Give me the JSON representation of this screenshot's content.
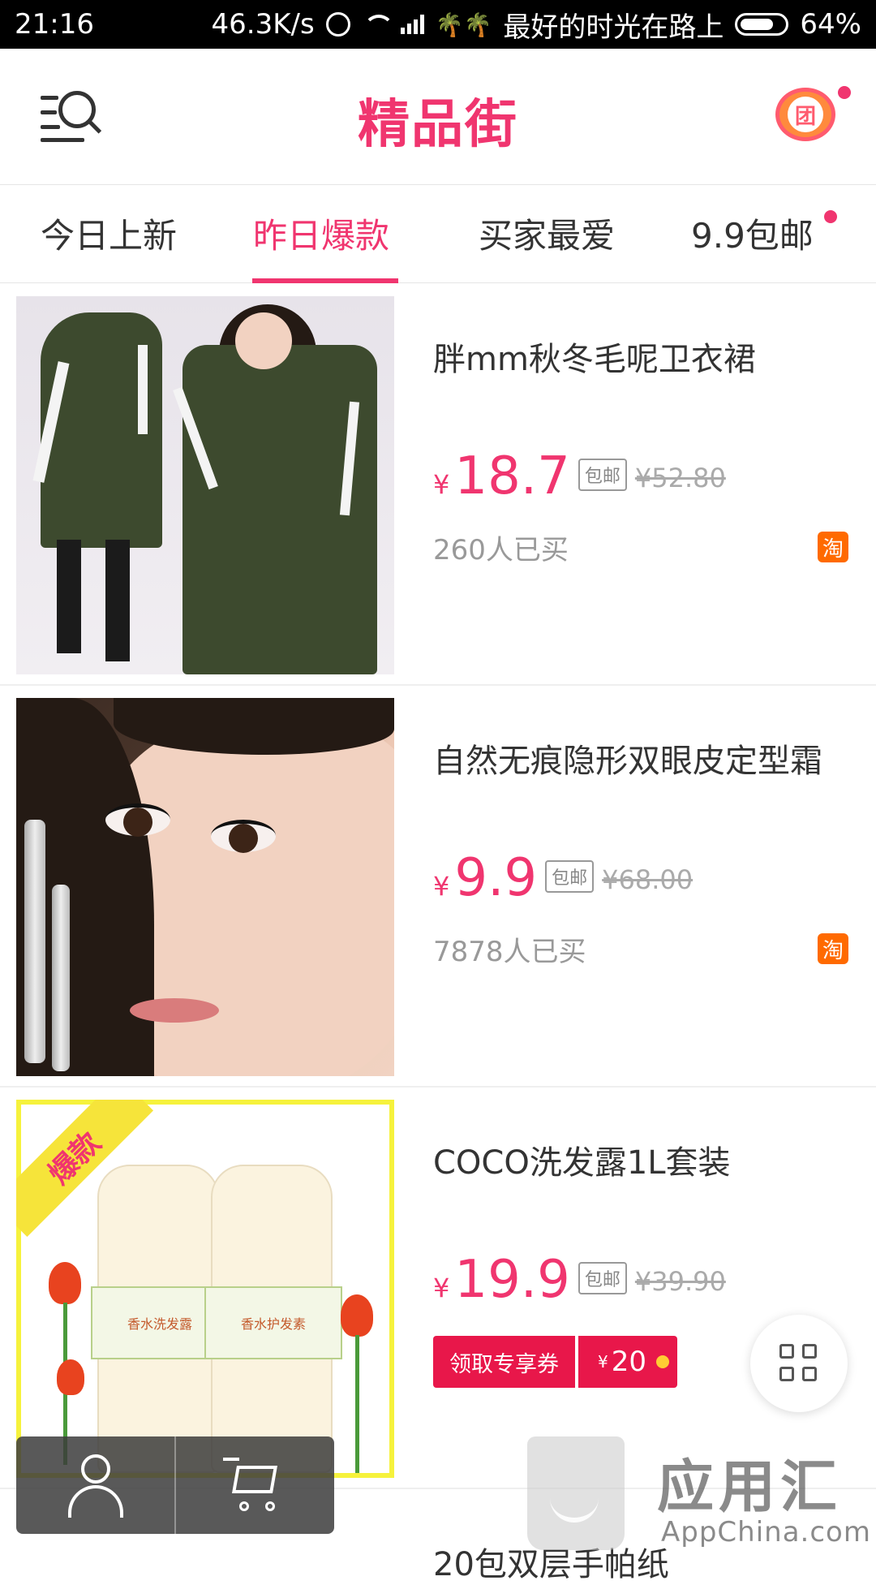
{
  "status_bar": {
    "time": "21:16",
    "network_speed": "46.3K/s",
    "carrier_text": "最好的时光在路上",
    "battery": "64%"
  },
  "header": {
    "title": "精品街",
    "search_icon": "menu-search-icon",
    "group_button_glyph": "团"
  },
  "tabs": [
    {
      "label": "今日上新",
      "active": false
    },
    {
      "label": "昨日爆款",
      "active": true
    },
    {
      "label": "买家最爱",
      "active": false
    },
    {
      "label": "9.9包邮",
      "active": false
    }
  ],
  "products": [
    {
      "name": "胖mm秋冬毛呢卫衣裙",
      "currency": "¥",
      "price": "18.7",
      "free_shipping": "包邮",
      "original_price": "¥52.80",
      "sold": "260人已买",
      "platform": "淘"
    },
    {
      "name": "自然无痕隐形双眼皮定型霜",
      "currency": "¥",
      "price": "9.9",
      "free_shipping": "包邮",
      "original_price": "¥68.00",
      "sold": "7878人已买",
      "platform": "淘"
    },
    {
      "name": "COCO洗发露1L套装",
      "currency": "¥",
      "price": "19.9",
      "free_shipping": "包邮",
      "original_price": "¥39.90",
      "coupon_label": "领取专享券",
      "coupon_currency": "¥",
      "coupon_amount": "20",
      "badge": "爆款"
    }
  ],
  "next_product_partial": "20包双层手帕纸",
  "watermark": {
    "text": "应用汇",
    "sub": "AppChina.com"
  },
  "colors": {
    "accent": "#f0356f",
    "coupon": "#e8174a",
    "taobao": "#ff6a00"
  }
}
